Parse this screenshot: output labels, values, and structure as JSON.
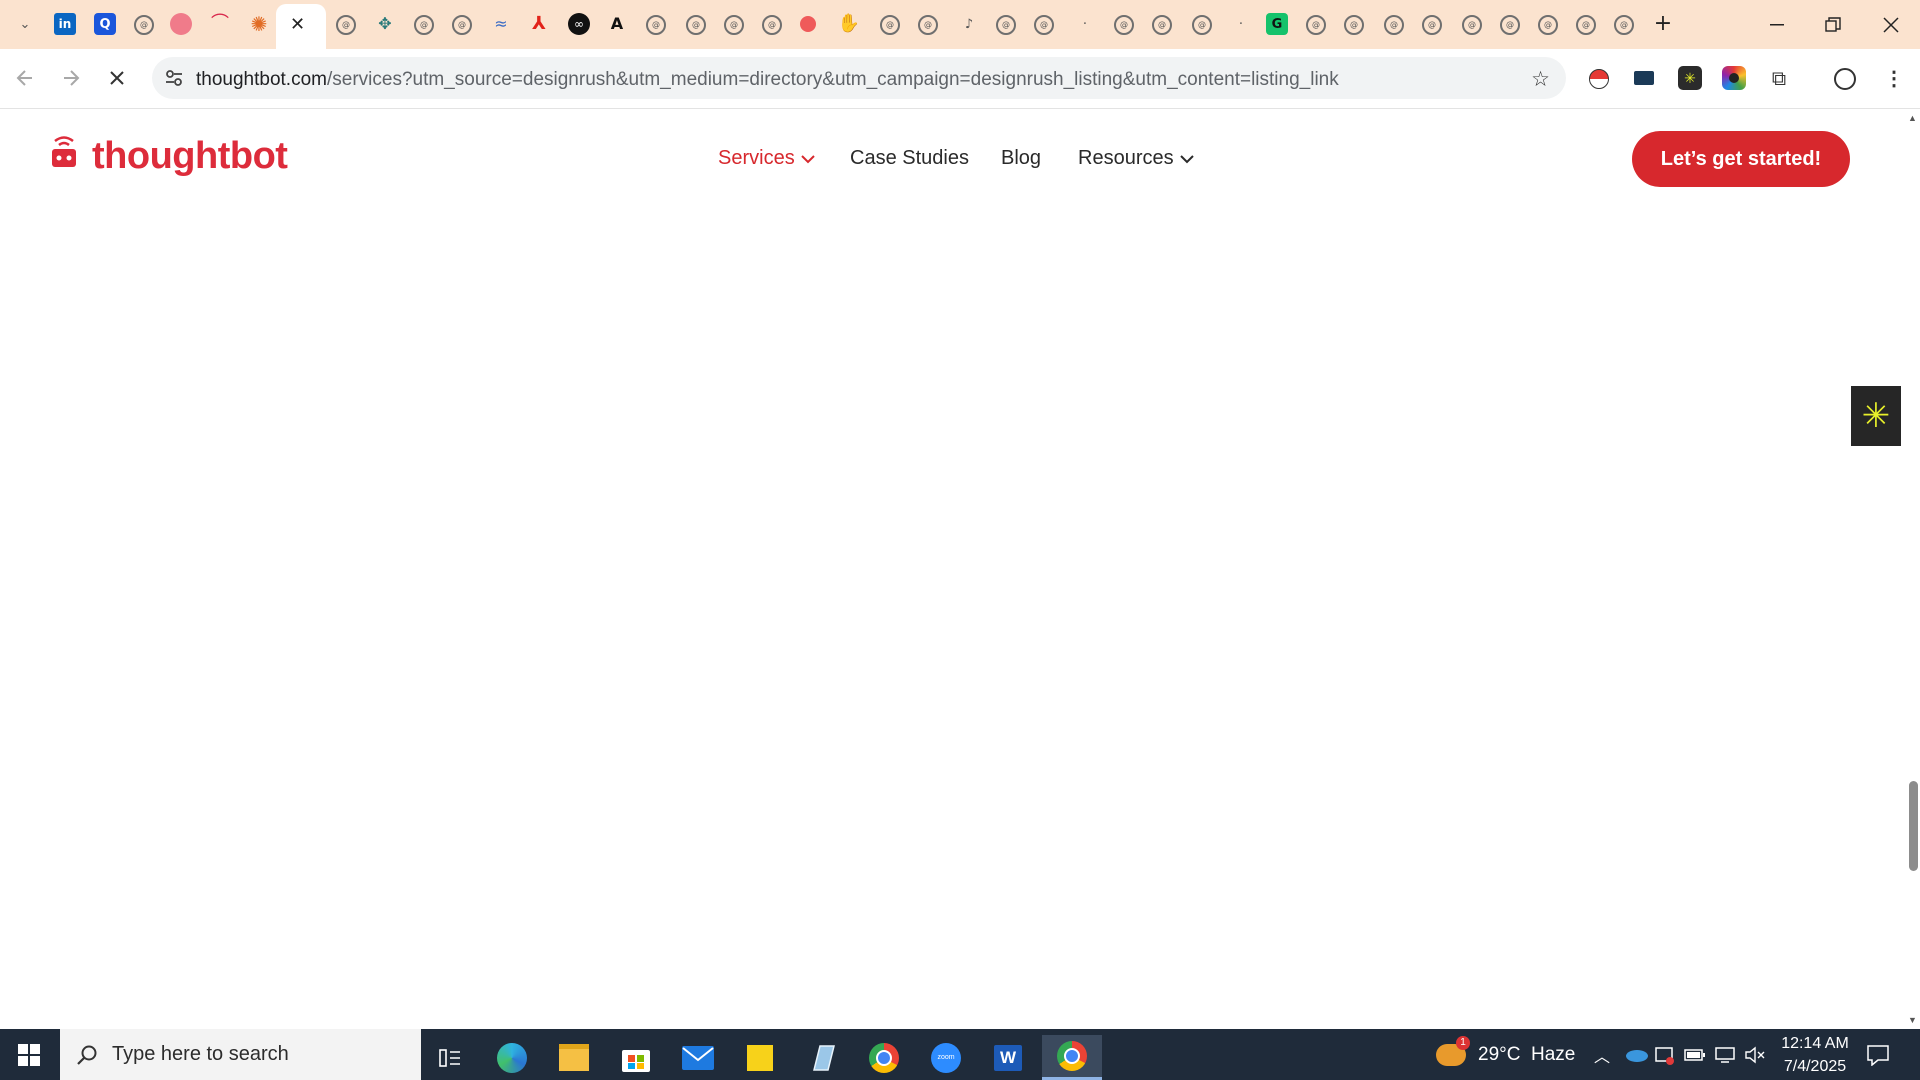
{
  "browser": {
    "address_bar": {
      "host": "thoughtbot.com",
      "path": "/services?utm_source=designrush&utm_medium=directory&utm_campaign=designrush_listing&utm_content=listing_link"
    },
    "tab_icons": [
      "list-tabs",
      "linkedin",
      "q-app",
      "chatgpt",
      "pink-circle",
      "toggl",
      "claude",
      "active-close",
      "openai-1",
      "perplexity",
      "openai-2",
      "openai-3",
      "copilot",
      "acrobat",
      "meta",
      "a-app",
      "openai-4",
      "openai-5",
      "openai-6",
      "openai-7",
      "red-dot",
      "hand",
      "openai-8",
      "openai-9",
      "openai-10",
      "openai-11",
      "openai-12",
      "openai-13",
      "openai-14",
      "openai-15",
      "openai-16",
      "openai-17",
      "grammarly",
      "openai-18",
      "openai-19",
      "openai-20",
      "openai-21",
      "openai-22",
      "openai-23",
      "openai-24",
      "openai-25",
      "openai-26",
      "new-tab"
    ]
  },
  "site": {
    "logo_text": "thoughtbot",
    "nav": {
      "services": "Services",
      "case_studies": "Case Studies",
      "blog": "Blog",
      "resources": "Resources"
    },
    "cta": "Let’s get started!",
    "colors": {
      "brand": "#dd2c3b",
      "cta": "#d7282d"
    }
  },
  "taskbar": {
    "search_placeholder": "Type here to search",
    "weather": "29°C  Haze",
    "weather_badge": "1",
    "time": "12:14 AM",
    "date": "7/4/2025"
  }
}
